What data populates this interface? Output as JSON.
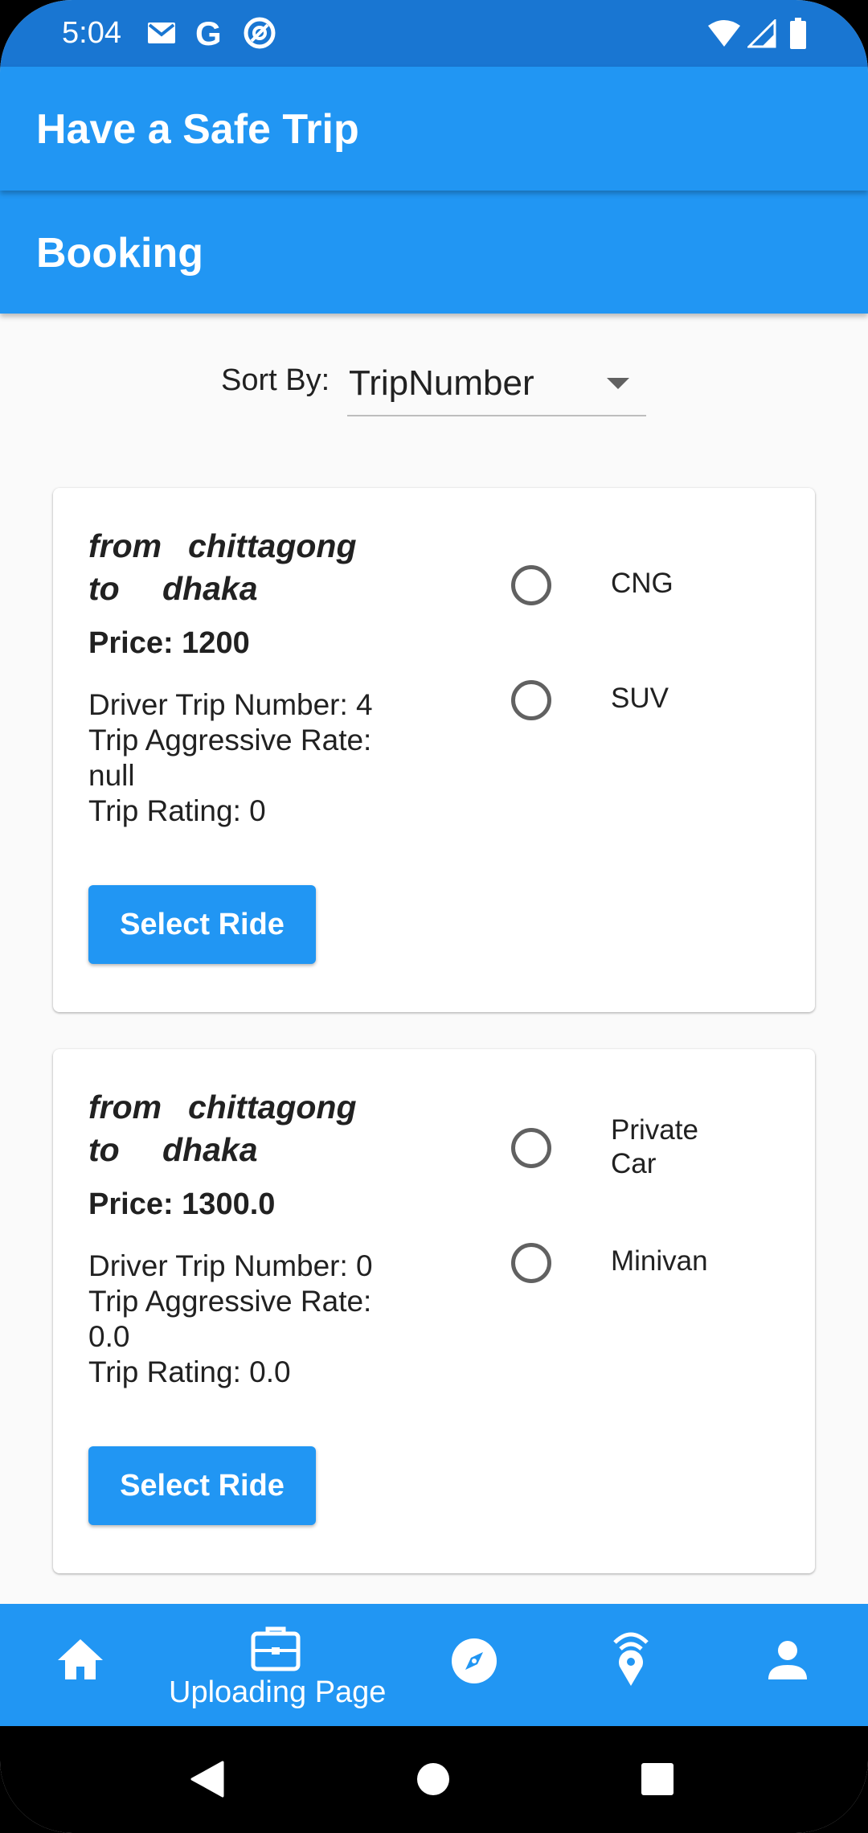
{
  "status_bar": {
    "time": "5:04",
    "icons": [
      "gmail-icon",
      "google-icon",
      "circle-a-icon",
      "wifi-icon",
      "signal-icon",
      "battery-icon"
    ],
    "google_glyph": "G"
  },
  "app_bar": {
    "title": "Have a Safe Trip"
  },
  "sub_bar": {
    "title": "Booking"
  },
  "sort": {
    "label": "Sort By:",
    "selected": "TripNumber"
  },
  "cards": [
    {
      "from_kw": "from",
      "from_city": "chittagong",
      "to_kw": "to",
      "to_city": "dhaka",
      "price": "Price: 1200",
      "driver_trip_number": "Driver Trip Number: 4",
      "aggressive_rate_label": "Trip Aggressive Rate:",
      "aggressive_rate_value": "null",
      "trip_rating": "Trip Rating: 0",
      "vehicle_options": [
        "CNG",
        "SUV"
      ],
      "button_label": "Select Ride"
    },
    {
      "from_kw": "from",
      "from_city": "chittagong",
      "to_kw": "to",
      "to_city": "dhaka",
      "price": "Price: 1300.0",
      "driver_trip_number": "Driver Trip Number: 0",
      "aggressive_rate_label": "Trip Aggressive Rate:",
      "aggressive_rate_value": "0.0",
      "trip_rating": "Trip Rating: 0.0",
      "vehicle_options": [
        "Private Car",
        "Minivan"
      ],
      "vehicle_option_lines": [
        [
          "Private",
          "Car"
        ],
        [
          "Minivan"
        ]
      ],
      "button_label": "Select Ride"
    }
  ],
  "bottom_nav": {
    "items": [
      "home-icon",
      "briefcase-icon",
      "compass-icon",
      "location-signal-icon",
      "person-icon"
    ],
    "active_label": "Uploading Page"
  },
  "colors": {
    "primary": "#2196F3",
    "status_bar": "#1976D2",
    "background": "#fafafa"
  }
}
